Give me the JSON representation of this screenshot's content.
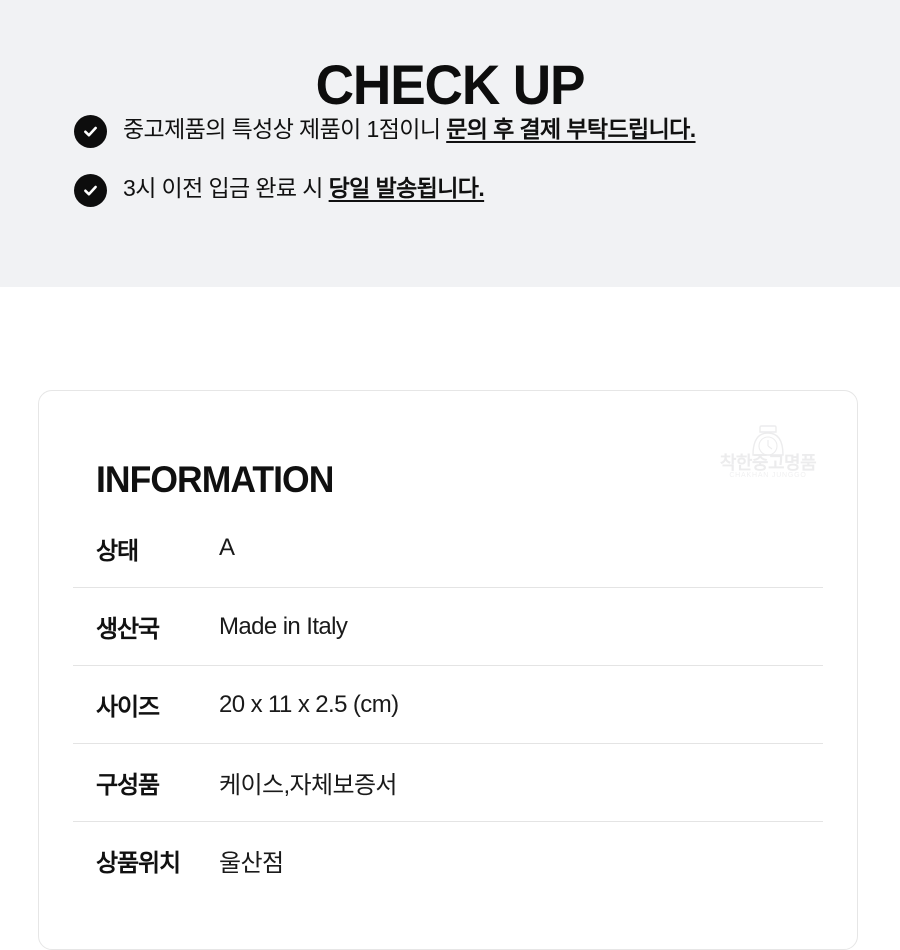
{
  "checkup": {
    "title": "CHECK UP",
    "bullets": [
      {
        "icon": "check-circle-icon",
        "plain": "중고제품의 특성상 제품이 1점이니 ",
        "emphasis": "문의 후 결제 부탁드립니다."
      },
      {
        "icon": "check-circle-icon",
        "plain": "3시 이전 입금 완료 시 ",
        "emphasis": "당일 발송됩니다."
      }
    ]
  },
  "information": {
    "title": "INFORMATION",
    "watermark": {
      "icon": "watch-logo-icon",
      "text": "착한중고명품",
      "subtext": "CHAKHAN JUNGGO"
    },
    "rows": [
      {
        "label": "상태",
        "value": "A"
      },
      {
        "label": "생산국",
        "value": "Made in Italy"
      },
      {
        "label": "사이즈",
        "value": "20 x 11 x 2.5 (cm)"
      },
      {
        "label": "구성품",
        "value": "케이스,자체보증서"
      },
      {
        "label": "상품위치",
        "value": "울산점"
      }
    ]
  },
  "colors": {
    "band_background": "#f1f2f4",
    "page_background": "#ffffff",
    "text": "#111111",
    "icon_fill": "#0d0d0d",
    "card_border": "#e6e6e6",
    "row_divider": "#e4e4e4"
  }
}
